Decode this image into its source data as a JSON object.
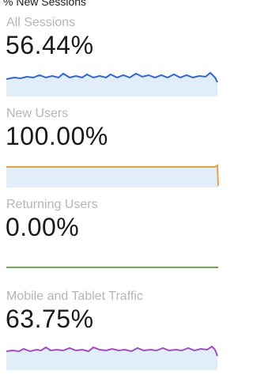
{
  "header": {
    "title": "% New Sessions"
  },
  "segments": [
    {
      "label": "All Sessions",
      "value": "56.44%",
      "line_color": "#3366cc",
      "fill_color": "#e1eefa"
    },
    {
      "label": "New Users",
      "value": "100.00%",
      "line_color": "#e8a24b",
      "fill_color": "#e1eefa"
    },
    {
      "label": "Returning Users",
      "value": "0.00%",
      "line_color": "#6aab4f",
      "fill_color": "#e1eefa"
    },
    {
      "label": "Mobile and Tablet Traffic",
      "value": "63.75%",
      "line_color": "#a24cc0",
      "fill_color": "#e1eefa"
    }
  ]
}
